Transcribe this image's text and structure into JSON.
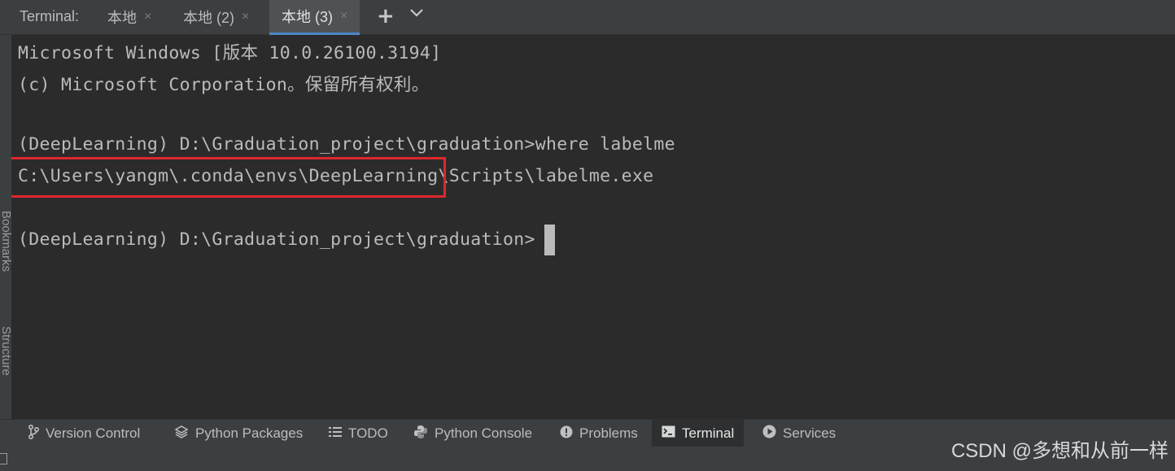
{
  "tabbar": {
    "title": "Terminal:",
    "tabs": [
      {
        "label": "本地",
        "close": "×"
      },
      {
        "label": "本地 (2)",
        "close": "×"
      },
      {
        "label": "本地 (3)",
        "close": "×"
      }
    ],
    "add_icon": "+",
    "dropdown_icon": "⌄"
  },
  "terminal": {
    "lines": [
      "Microsoft Windows [版本 10.0.26100.3194]",
      "(c) Microsoft Corporation。保留所有权利。",
      "",
      "(DeepLearning) D:\\Graduation_project\\graduation>where labelme",
      "C:\\Users\\yangm\\.conda\\envs\\DeepLearning\\Scripts\\labelme.exe",
      "",
      "(DeepLearning) D:\\Graduation_project\\graduation>"
    ],
    "highlight_color": "#e0262c"
  },
  "side_panel": {
    "bookmarks": "Bookmarks",
    "structure": "Structure"
  },
  "tool_windows": [
    {
      "label": "Version Control",
      "icon": "branch-icon"
    },
    {
      "label": "Python Packages",
      "icon": "layers-icon"
    },
    {
      "label": "TODO",
      "icon": "list-icon"
    },
    {
      "label": "Python Console",
      "icon": "python-icon"
    },
    {
      "label": "Problems",
      "icon": "info-icon"
    },
    {
      "label": "Terminal",
      "icon": "terminal-icon",
      "active": true
    },
    {
      "label": "Services",
      "icon": "play-icon"
    }
  ],
  "watermark": "CSDN @多想和从前一样"
}
